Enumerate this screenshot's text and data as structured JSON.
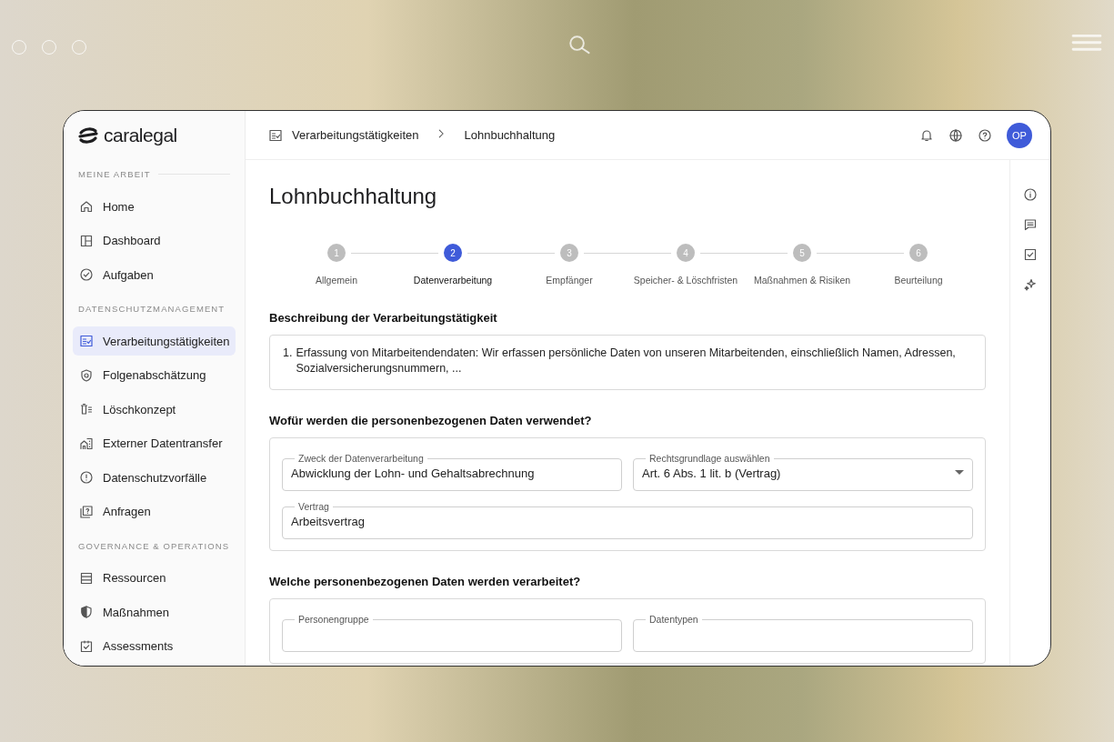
{
  "sidebar": {
    "logo": "caralegal",
    "sections": [
      {
        "title": "MEINE ARBEIT",
        "items": [
          {
            "label": "Home",
            "selected": false
          },
          {
            "label": "Dashboard",
            "selected": false
          },
          {
            "label": "Aufgaben",
            "selected": false
          }
        ]
      },
      {
        "title": "DATENSCHUTZMANAGEMENT",
        "items": [
          {
            "label": "Verarbeitungstätigkeiten",
            "selected": true
          },
          {
            "label": "Folgenabschätzung",
            "selected": false
          },
          {
            "label": "Löschkonzept",
            "selected": false
          },
          {
            "label": "Externer Datentransfer",
            "selected": false
          },
          {
            "label": "Datenschutzvorfälle",
            "selected": false
          },
          {
            "label": "Anfragen",
            "selected": false
          }
        ]
      },
      {
        "title": "GOVERNANCE & OPERATIONS",
        "items": [
          {
            "label": "Ressourcen",
            "selected": false
          },
          {
            "label": "Maßnahmen",
            "selected": false
          },
          {
            "label": "Assessments",
            "selected": false
          }
        ]
      }
    ]
  },
  "header": {
    "breadcrumb": [
      "Verarbeitungstätigkeiten",
      "Lohnbuchhaltung"
    ],
    "avatar": "OP"
  },
  "title": "Lohnbuchhaltung",
  "steps": [
    {
      "number": "1",
      "label": "Allgemein",
      "selected": false
    },
    {
      "number": "2",
      "label": "Datenverarbeitung",
      "selected": true
    },
    {
      "number": "3",
      "label": "Empfänger",
      "selected": false
    },
    {
      "number": "4",
      "label": "Speicher- & Löschfristen",
      "selected": false
    },
    {
      "number": "5",
      "label": "Maßnahmen & Risiken",
      "selected": false
    },
    {
      "number": "6",
      "label": "Beurteilung",
      "selected": false
    }
  ],
  "sections": [
    {
      "kind": "description",
      "heading": "Beschreibung der Verarbeitungstätigkeit",
      "items": [
        {
          "number": "1.",
          "text": "Erfassung von Mitarbeitendendaten: Wir erfassen persönliche Daten von unseren Mitarbeitenden, einschließlich Namen, Adressen, Sozialversicherungsnummern, ..."
        }
      ]
    },
    {
      "kind": "fields",
      "heading": "Wofür werden die personenbezogenen Daten verwendet?",
      "rows": [
        [
          {
            "kind": "text",
            "label": "Zweck der Datenverarbeitung",
            "value": "Abwicklung der Lohn- und Gehaltsabrechnung"
          },
          {
            "kind": "select",
            "label": "Rechtsgrundlage auswählen",
            "value": "Art. 6 Abs. 1 lit. b (Vertrag)"
          }
        ],
        [
          {
            "kind": "text",
            "label": "Vertrag",
            "value": "Arbeitsvertrag"
          }
        ]
      ]
    },
    {
      "kind": "fields",
      "heading": "Welche personenbezogenen Daten werden verarbeitet?",
      "rows": [
        [
          {
            "kind": "text",
            "label": "Personengruppe"
          },
          {
            "kind": "text",
            "label": "Datentypen"
          }
        ]
      ]
    }
  ]
}
